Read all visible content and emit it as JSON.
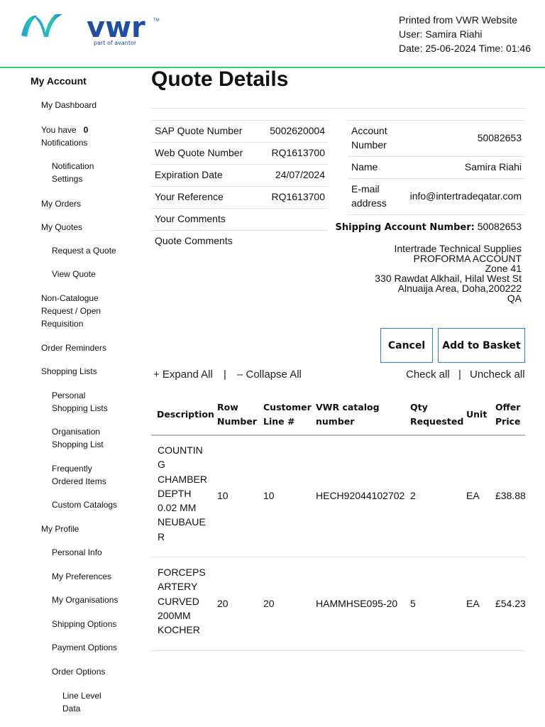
{
  "header": {
    "logo_text": "vwr",
    "logo_tagline": "part of avantor",
    "printed_from": "Printed from VWR Website",
    "user": "User:  Samira  Riahi",
    "datetime": "Date: 25-06-2024  Time: 01:46"
  },
  "sidebar": {
    "title": "My Account",
    "items": {
      "dashboard": "My Dashboard",
      "you_have": "You have",
      "notif_count": "0",
      "notifications": "Notifications",
      "notif_settings_1": "Notification",
      "notif_settings_2": "Settings",
      "orders": "My Orders",
      "quotes": "My Quotes",
      "request_quote": "Request a Quote",
      "view_quote": "View Quote",
      "noncat_1": "Non-Catalogue",
      "noncat_2": "Request / Open",
      "noncat_3": "Requisition",
      "order_reminders": "Order Reminders",
      "shopping_lists": "Shopping Lists",
      "personal_sl_1": "Personal",
      "personal_sl_2": "Shopping Lists",
      "org_sl_1": "Organisation",
      "org_sl_2": "Shopping List",
      "freq_1": "Frequently",
      "freq_2": "Ordered Items",
      "custom_catalogs": "Custom Catalogs",
      "profile": "My Profile",
      "personal_info": "Personal Info",
      "preferences": "My Preferences",
      "organisations": "My Organisations",
      "shipping_options": "Shipping Options",
      "payment_options": "Payment Options",
      "order_options": "Order Options",
      "line_level_1": "Line Level",
      "line_level_2": "Data"
    }
  },
  "main": {
    "title": "Quote Details",
    "quote_info": [
      {
        "label": "SAP Quote Number",
        "value": "5002620004"
      },
      {
        "label": "Web Quote Number",
        "value": "RQ1613700"
      },
      {
        "label": "Expiration Date",
        "value": "24/07/2024"
      },
      {
        "label": "Your Reference",
        "value": "RQ1613700"
      },
      {
        "label": "Your Comments",
        "value": ""
      },
      {
        "label": "Quote Comments",
        "value": ""
      }
    ],
    "account": {
      "account_label_1": "Account",
      "account_label_2": "Number",
      "account_number": "50082653",
      "name_label": "Name",
      "name": "Samira Riahi",
      "email_label_1": "E-mail",
      "email_label_2": "address",
      "email": "info@intertradeqatar.com",
      "shipping_label": "Shipping Account Number:",
      "shipping_number": "50082653",
      "address": [
        "Intertrade Technical Supplies",
        "PROFORMA ACCOUNT",
        "Zone 41",
        "330 Rawdat Alkhail, Hilal West St",
        "Alnuaija Area, Doha,200222",
        "QA"
      ]
    },
    "buttons": {
      "cancel": "Cancel",
      "add_to_basket": "Add to Basket"
    },
    "links": {
      "expand_all": "+ Expand All",
      "sep": "|",
      "collapse_all": "–  Collapse All",
      "check_all": "Check all",
      "uncheck_all": "Uncheck all"
    },
    "table": {
      "headers": [
        [
          "Description"
        ],
        [
          "Row",
          "Number"
        ],
        [
          "Customer",
          "Line #"
        ],
        [
          "VWR catalog",
          "number"
        ],
        [
          "Qty",
          "Requested"
        ],
        [
          "Unit"
        ],
        [
          "Offer",
          "Price"
        ]
      ],
      "rows": [
        {
          "description": [
            "COUNTIN",
            "G",
            "CHAMBER",
            "DEPTH",
            "0.02 MM",
            "NEUBAUE",
            "R"
          ],
          "row": "10",
          "customer_line": "10",
          "catalog": "HECH92044102702",
          "qty": "2",
          "unit": "EA",
          "price": "£38.88"
        },
        {
          "description": [
            "FORCEPS",
            "ARTERY",
            "CURVED",
            "200MM",
            "KOCHER"
          ],
          "row": "20",
          "customer_line": "20",
          "catalog": "HAMMHSE095-20",
          "qty": "5",
          "unit": "EA",
          "price": "£54.23"
        }
      ]
    }
  },
  "colors": {
    "accent_green": "#2fd36a",
    "button_border": "#2a7de1"
  }
}
